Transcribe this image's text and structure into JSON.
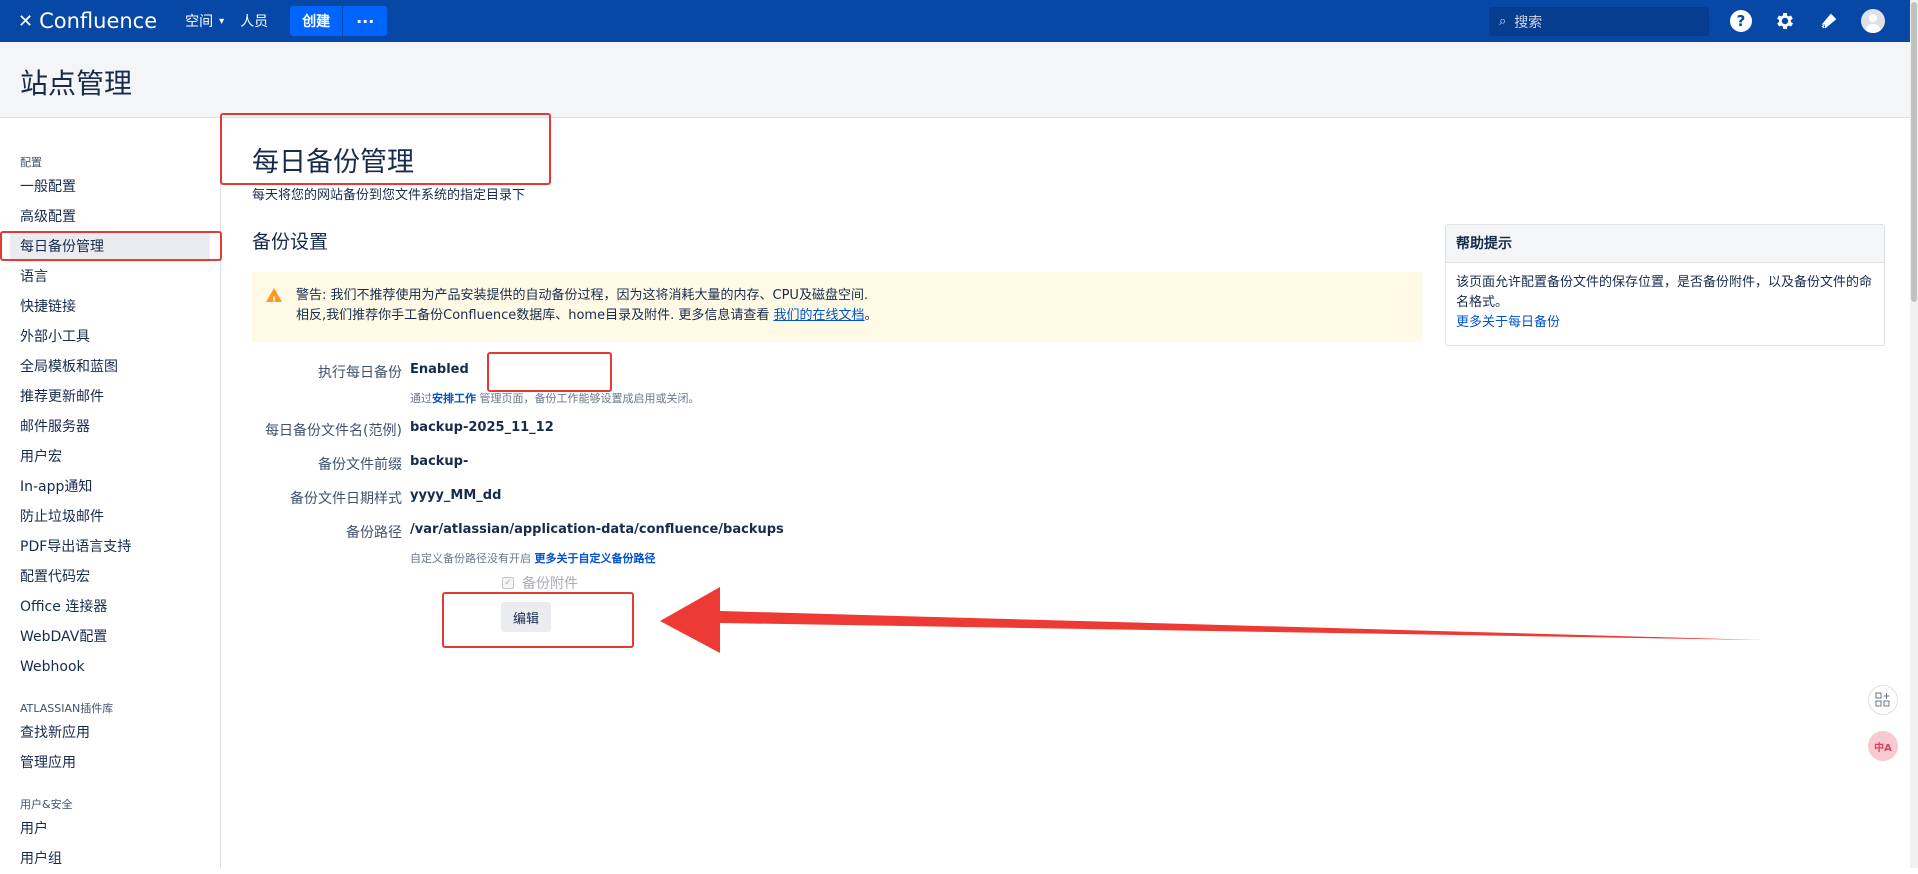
{
  "topbar": {
    "logo": "Confluence",
    "nav": [
      "空间",
      "人员"
    ],
    "create": "创建",
    "more": "···",
    "search_placeholder": "搜索"
  },
  "header": {
    "title": "站点管理"
  },
  "sidebar": {
    "sections": [
      {
        "title": "配置",
        "items": [
          "一般配置",
          "高级配置",
          "每日备份管理",
          "语言",
          "快捷链接",
          "外部小工具",
          "全局模板和蓝图",
          "推荐更新邮件",
          "邮件服务器",
          "用户宏",
          "In-app通知",
          "防止垃圾邮件",
          "PDF导出语言支持",
          "配置代码宏",
          "Office 连接器",
          "WebDAV配置",
          "Webhook"
        ]
      },
      {
        "title": "ATLASSIAN插件库",
        "items": [
          "查找新应用",
          "管理应用"
        ]
      },
      {
        "title": "用户&安全",
        "items": [
          "用户",
          "用户组"
        ]
      }
    ],
    "active": "每日备份管理"
  },
  "main": {
    "heading": "每日备份管理",
    "description": "每天将您的网站备份到您文件系统的指定目录下",
    "section_title": "备份设置",
    "warning": {
      "line1": "警告: 我们不推荐使用为产品安装提供的自动备份过程，因为这将消耗大量的内存、CPU及磁盘空间.",
      "line2_prefix": "相反,我们推荐你手工备份Confluence数据库、home目录及附件. 更多信息请查看 ",
      "line2_link": "我们的在线文档",
      "line2_suffix": "。"
    },
    "fields": {
      "daily_backup_label": "执行每日备份",
      "daily_backup_value": "Enabled",
      "schedule_note_prefix": "通过",
      "schedule_note_link": "安排工作",
      "schedule_note_suffix": " 管理页面，备份工作能够设置成启用或关闭。",
      "filename_label": "每日备份文件名(范例)",
      "filename_value": "backup-2025_11_12",
      "prefix_label": "备份文件前缀",
      "prefix_value": "backup-",
      "date_format_label": "备份文件日期样式",
      "date_format_value": "yyyy_MM_dd",
      "path_label": "备份路径",
      "path_value": "/var/atlassian/application-data/confluence/backups",
      "path_note_prefix": "自定义备份路径没有开启 ",
      "path_note_link": "更多关于自定义备份路径",
      "attachments_label": "备份附件",
      "edit_button": "编辑"
    }
  },
  "help": {
    "title": "帮助提示",
    "body": "该页面允许配置备份文件的保存位置，是否备份附件，以及备份文件的命名格式。",
    "link": "更多关于每日备份"
  },
  "colors": {
    "topbar": "#0747a6",
    "annotation": "#e53935",
    "warning_bg": "#fffae6"
  }
}
